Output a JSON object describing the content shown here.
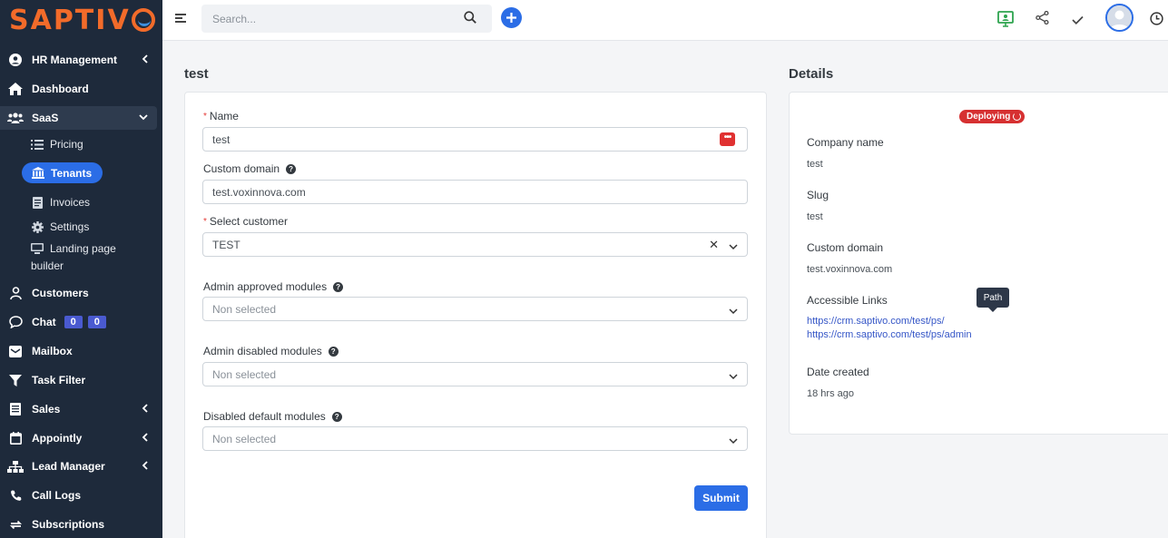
{
  "brand": {
    "logo_text_a": "SAPTIV",
    "accent": "#2b6de6",
    "brand_color": "#f26b2a"
  },
  "sidebar": {
    "items": [
      {
        "label": "HR Management",
        "icon": "user-circle-icon",
        "chevron": "‹"
      },
      {
        "label": "Dashboard",
        "icon": "home-icon"
      },
      {
        "label": "SaaS",
        "icon": "users-icon",
        "chevron": "⌄"
      },
      {
        "label": "Customers",
        "icon": "user-icon"
      },
      {
        "label": "Chat",
        "icon": "chat-icon",
        "badges": [
          "0",
          "0"
        ]
      },
      {
        "label": "Mailbox",
        "icon": "mailbox-icon"
      },
      {
        "label": "Task Filter",
        "icon": "filter-icon"
      },
      {
        "label": "Sales",
        "icon": "document-icon",
        "chevron": "‹"
      },
      {
        "label": "Appointly",
        "icon": "calendar-icon",
        "chevron": "‹"
      },
      {
        "label": "Lead Manager",
        "icon": "sitemap-icon",
        "chevron": "‹"
      },
      {
        "label": "Call Logs",
        "icon": "phone-icon"
      },
      {
        "label": "Subscriptions",
        "icon": "sync-icon"
      }
    ],
    "saas_sub": [
      {
        "label": "Pricing",
        "icon": "list-icon"
      },
      {
        "label": "Tenants",
        "icon": "bank-icon"
      },
      {
        "label": "Invoices",
        "icon": "invoice-icon"
      },
      {
        "label": "Settings",
        "icon": "gear-icon"
      },
      {
        "label_1": "Landing page",
        "label_2": "builder",
        "icon": "desktop-icon"
      }
    ]
  },
  "topbar": {
    "search_placeholder": "Search..."
  },
  "form": {
    "title": "test",
    "name_label": "Name",
    "name_value": "test",
    "domain_label": "Custom domain",
    "domain_value": "test.voxinnova.com",
    "customer_label": "Select customer",
    "customer_value": "TEST",
    "approved_label": "Admin approved modules",
    "approved_value": "Non selected",
    "disabled_label": "Admin disabled modules",
    "disabled_value": "Non selected",
    "default_label": "Disabled default modules",
    "default_value": "Non selected",
    "submit_label": "Submit"
  },
  "details": {
    "title": "Details",
    "status": "Deploying",
    "company_label": "Company name",
    "company_value": "test",
    "slug_label": "Slug",
    "slug_value": "test",
    "domain_label": "Custom domain",
    "domain_value": "test.voxinnova.com",
    "links_label": "Accessible Links",
    "link_1": "https://crm.saptivo.com/test/ps/",
    "link_2": "https://crm.saptivo.com/test/ps/admin",
    "tooltip": "Path",
    "created_label": "Date created",
    "created_value": "18 hrs ago"
  }
}
